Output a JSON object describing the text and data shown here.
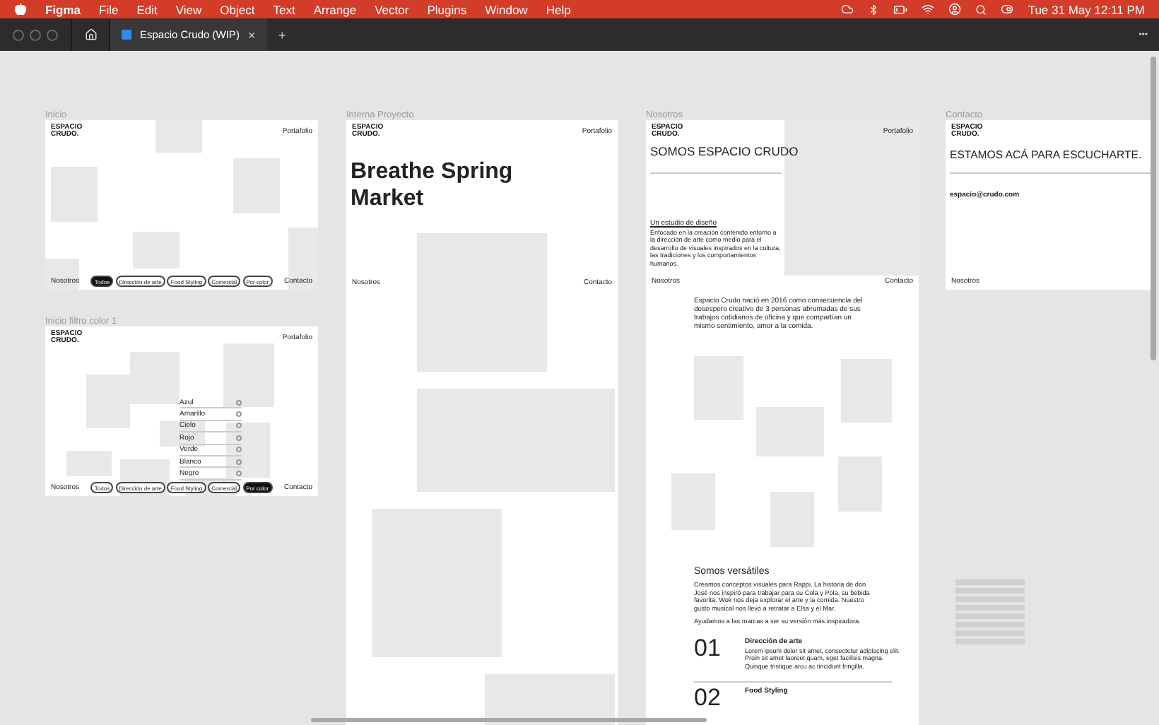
{
  "menubar": {
    "app": "Figma",
    "menus": [
      "File",
      "Edit",
      "View",
      "Object",
      "Text",
      "Arrange",
      "Vector",
      "Plugins",
      "Window",
      "Help"
    ],
    "clock": "Tue 31 May  12:11 PM"
  },
  "tabbar": {
    "tabs": [
      {
        "label": "Espacio Crudo (WIP)",
        "selected": true
      }
    ],
    "close": "×",
    "add": "+",
    "more": "•••"
  },
  "frames": [
    {
      "kind": "home",
      "label": "Inicio",
      "logo": "ESPACIO CRUDO.",
      "top_link": "Portafolio",
      "bottom_left": "Nosotros",
      "bottom_right": "Contacto",
      "filters": [
        {
          "label": "Todos",
          "selected": true
        },
        {
          "label": "Dirección de arte",
          "selected": false
        },
        {
          "label": "Food Styling",
          "selected": false
        },
        {
          "label": "Comercial",
          "selected": false
        },
        {
          "label": "Por color",
          "selected": false
        }
      ]
    },
    {
      "kind": "filter",
      "label": "Inicio filtro color 1",
      "logo": "ESPACIO CRUDO.",
      "top_link": "Portafolio",
      "bottom_left": "Nosotros",
      "bottom_right": "Contacto",
      "colors": [
        "Azul",
        "Amarillo",
        "Cielo",
        "Rojo",
        "Verde",
        "Blanco",
        "Negro"
      ],
      "filters": [
        {
          "label": "Todos",
          "selected": false
        },
        {
          "label": "Dirección de arte",
          "selected": false
        },
        {
          "label": "Food Styling",
          "selected": false
        },
        {
          "label": "Comercial",
          "selected": false
        },
        {
          "label": "Por color",
          "selected": true
        }
      ]
    },
    {
      "kind": "project",
      "label": "Interna Proyecto",
      "logo": "ESPACIO CRUDO.",
      "top_link": "Portafolio",
      "bottom_left": "Nosotros",
      "bottom_right": "Contacto",
      "title": "Breathe Spring Market"
    },
    {
      "kind": "about",
      "label": "Nosotros",
      "logo": "ESPACIO CRUDO.",
      "top_link": "Portafolio",
      "bottom_left": "Nosotros",
      "bottom_right": "Contacto",
      "headline": "SOMOS ESPACIO CRUDO",
      "subtitle": "Un estudio de diseño",
      "intro": "Enfocado en la creación contenido entorno a la dirección de arte como medio para el desarrollo de visuales inspirados en la cultura, las tradiciones y los comportamientos humanos.",
      "story": "Espacio Crudo nació en 2016 como consecuencia del desespero creativo de 3 personas abrumadas de sus trabajos cotidianos de oficina y que compartían un mismo sentimiento, amor a la comida.",
      "section_title": "Somos versátiles",
      "section_text": "Creamos conceptos visuales para Rappi. La historia de don José nos inspiró para trabajar para su Cola y Pola, su bebida favorita. Wok nos deja explorar el arte y la comida. Nuestro gusto musical nos llevó a retratar a Elsa y el Mar.",
      "section_note": "Ayudamos a las marcas a ser su versión más inspiradora.",
      "services": [
        {
          "number": "01",
          "title": "Dirección de arte",
          "text": "Lorem ipsum dolor sit amet, consectetur adipiscing elit. Proin sit amet laoreet quam, eget facilisis magna. Quisque tristique arcu ac tincidunt fringilla."
        },
        {
          "number": "02",
          "title": "Food Styling"
        }
      ]
    },
    {
      "kind": "contact",
      "label": "Contacto",
      "logo": "ESPACIO CRUDO.",
      "bottom_left": "Nosotros",
      "headline": "ESTAMOS ACÁ PARA ESCUCHARTE.",
      "email": "espacio@crudo.com"
    }
  ]
}
